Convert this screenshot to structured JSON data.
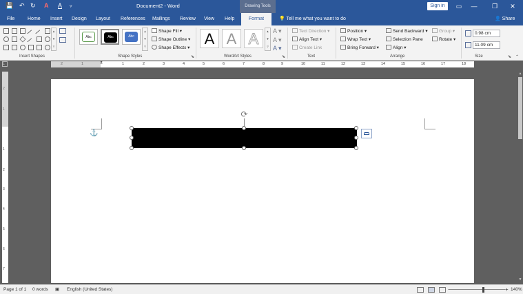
{
  "window": {
    "doc_title": "Document2 - Word",
    "contextual_tab": "Drawing Tools",
    "signin": "Sign in",
    "min_glyph": "—",
    "restore_glyph": "❐",
    "close_glyph": "✕"
  },
  "quick_access": {
    "save": "💾",
    "undo": "↶",
    "redo": "↻",
    "font_color": "A",
    "highlight": "A",
    "customize": "▿"
  },
  "tabs": [
    {
      "label": "File"
    },
    {
      "label": "Home"
    },
    {
      "label": "Insert"
    },
    {
      "label": "Design"
    },
    {
      "label": "Layout"
    },
    {
      "label": "References"
    },
    {
      "label": "Mailings"
    },
    {
      "label": "Review"
    },
    {
      "label": "View"
    },
    {
      "label": "Help"
    },
    {
      "label": "Format"
    }
  ],
  "tellme": "Tell me what you want to do",
  "share": "Share",
  "ribbon": {
    "groups": {
      "insert_shapes": "Insert Shapes",
      "shape_styles": "Shape Styles",
      "wordart_styles": "WordArt Styles",
      "text": "Text",
      "arrange": "Arrange",
      "size": "Size"
    },
    "shape_style_samples": [
      "Abc",
      "Abc",
      "Abc"
    ],
    "shape_fill": "Shape Fill",
    "shape_outline": "Shape Outline",
    "shape_effects": "Shape Effects",
    "wordart_sample": "A",
    "text_direction": "Text Direction",
    "align_text": "Align Text",
    "create_link": "Create Link",
    "position": "Position",
    "wrap_text": "Wrap Text",
    "bring_forward": "Bring Forward",
    "send_backward": "Send Backward",
    "selection_pane": "Selection Pane",
    "align": "Align",
    "group": "Group",
    "rotate": "Rotate",
    "height": "0.98 cm",
    "width": "11.09 cm"
  },
  "ruler": {
    "numbers": [
      "2",
      "1",
      "1",
      "2",
      "3",
      "4",
      "5",
      "6",
      "7",
      "8",
      "9",
      "10",
      "11",
      "12",
      "13",
      "14",
      "15",
      "16",
      "17",
      "18"
    ]
  },
  "vruler": {
    "numbers": [
      "2",
      "1",
      "1",
      "2",
      "3",
      "4",
      "5",
      "6",
      "7",
      "8"
    ]
  },
  "statusbar": {
    "page": "Page 1 of 1",
    "words": "0 words",
    "language": "English (United States)",
    "zoom": "140%",
    "minus": "−",
    "plus": "+"
  },
  "colors": {
    "brand": "#2b579a",
    "shape_fill": "#000000"
  }
}
